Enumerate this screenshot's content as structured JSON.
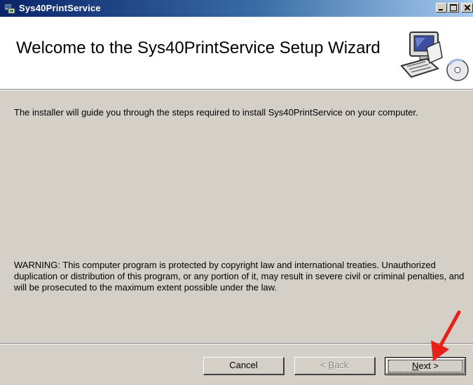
{
  "window": {
    "title": "Sys40PrintService",
    "banner_title": "Welcome to the Sys40PrintService Setup Wizard"
  },
  "body": {
    "intro": "The installer will guide you through the steps required to install Sys40PrintService on your computer.",
    "warning": "WARNING: This computer program is protected by copyright law and international treaties. Unauthorized duplication or distribution of this program, or any portion of it, may result in severe civil or criminal penalties, and will be prosecuted to the maximum extent possible under the law."
  },
  "buttons": {
    "cancel": "Cancel",
    "back_prefix": "< ",
    "back_accel": "B",
    "back_rest": "ack",
    "next_accel": "N",
    "next_rest": "ext >"
  },
  "colors": {
    "face": "#d4d0c8",
    "titlebar_start": "#0a246a",
    "titlebar_end": "#a6caf0",
    "annotation_arrow": "#e8201a"
  },
  "icons": {
    "title": "installer-icon",
    "banner": "computer-cd-icon",
    "annotation": "red-arrow-icon"
  },
  "state": {
    "back_enabled": false,
    "default_button": "next"
  }
}
